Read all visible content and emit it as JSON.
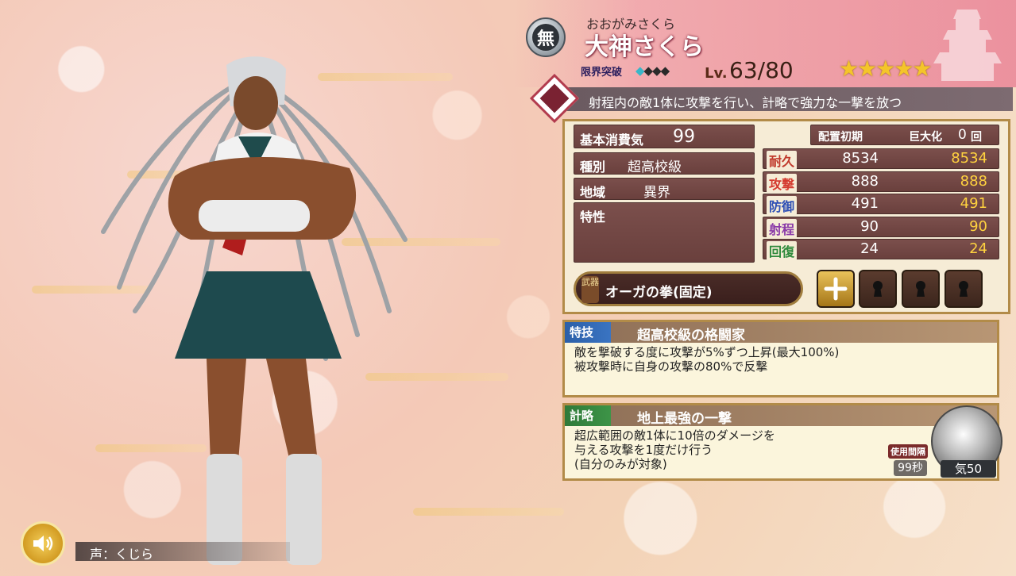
{
  "character": {
    "attribute_icon": "無",
    "ruby": "おおがみさくら",
    "name": "大神さくら",
    "limit_break_label": "限界突破",
    "limit_break": {
      "filled": 1,
      "total": 4
    },
    "level_label": "Lv.",
    "level": "63/80",
    "rarity_stars": 5
  },
  "skill_summary": "射程内の敵1体に攻撃を行い、計略で強力な一撃を放つ",
  "stats": {
    "cost_label": "基本消費気",
    "cost": "99",
    "type_label": "種別",
    "type": "超高校級",
    "region_label": "地域",
    "region": "異界",
    "trait_label": "特性",
    "trait": "",
    "deploy_label": "配置初期",
    "giant_label": "巨大化",
    "giant_count": "0",
    "giant_unit": "回",
    "rows": [
      {
        "label": "耐久",
        "base": "8534",
        "current": "8534",
        "color": "#c0392b"
      },
      {
        "label": "攻撃",
        "base": "888",
        "current": "888",
        "color": "#d43a2f"
      },
      {
        "label": "防御",
        "base": "491",
        "current": "491",
        "color": "#2e4fb5"
      },
      {
        "label": "射程",
        "base": "90",
        "current": "90",
        "color": "#8a3aa8"
      },
      {
        "label": "回復",
        "base": "24",
        "current": "24",
        "color": "#2f8a3c"
      }
    ]
  },
  "weapon": {
    "tag": "武器",
    "name": "オーガの拳(固定)",
    "add_icon": "plus-icon",
    "lock_icon": "keyhole-icon"
  },
  "special": {
    "tag": "特技",
    "title": "超高校級の格闘家",
    "lines": [
      "敵を撃破する度に攻撃が5%ずつ上昇(最大100%)",
      "被攻撃時に自身の攻撃の80%で反撃"
    ]
  },
  "strategy": {
    "tag": "計略",
    "title": "地上最強の一撃",
    "lines": [
      "超広範囲の敵1体に10倍のダメージを",
      "与える攻撃を1度だけ行う",
      "(自分のみが対象)"
    ],
    "interval_label": "使用間隔",
    "cooldown": "99秒",
    "cost": "気50"
  },
  "voice": {
    "label": "声：くじら",
    "icon": "speaker-icon"
  }
}
